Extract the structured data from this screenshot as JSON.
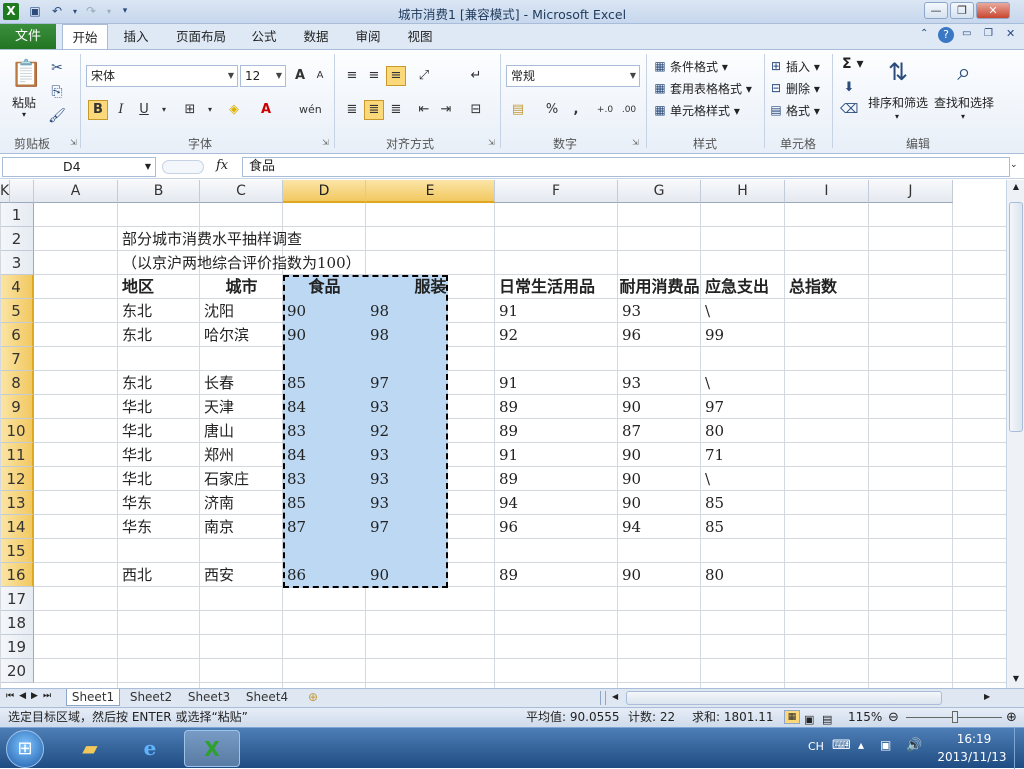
{
  "window": {
    "title": "城市消费1  [兼容模式]  -  Microsoft Excel",
    "app_icon": "X",
    "min": "—",
    "max": "❐",
    "close": "✕"
  },
  "ribbon_tabs": {
    "file": "文件",
    "items": [
      "开始",
      "插入",
      "页面布局",
      "公式",
      "数据",
      "审阅",
      "视图"
    ]
  },
  "ribbon": {
    "clipboard": {
      "paste": "粘贴",
      "label": "剪贴板"
    },
    "font": {
      "name": "宋体",
      "size": "12",
      "grow": "A",
      "shrink": "A",
      "bold": "B",
      "italic": "I",
      "underline": "U",
      "label": "字体"
    },
    "alignment": {
      "label": "对齐方式"
    },
    "number": {
      "format": "常规",
      "percent": "%",
      "comma": ",",
      "inc": "+.0",
      "dec": ".00",
      "label": "数字"
    },
    "styles": {
      "cond": "条件格式",
      "table": "套用表格格式",
      "cell": "单元格样式",
      "label": "样式"
    },
    "cells": {
      "insert": "插入",
      "delete": "删除",
      "format": "格式",
      "label": "单元格"
    },
    "editing": {
      "sigma": "Σ",
      "sort": "排序和筛选",
      "find": "查找和选择",
      "label": "编辑"
    }
  },
  "formula_bar": {
    "name_box": "D4",
    "fx": "fx",
    "value": "食品"
  },
  "columns": [
    "A",
    "B",
    "C",
    "D",
    "E",
    "F",
    "G",
    "H",
    "I",
    "J",
    "K"
  ],
  "rows": [
    "1",
    "2",
    "3",
    "4",
    "5",
    "6",
    "7",
    "8",
    "9",
    "10",
    "11",
    "12",
    "13",
    "14",
    "15",
    "16",
    "17",
    "18",
    "19",
    "20"
  ],
  "sheet": {
    "title": "部分城市消费水平抽样调查",
    "subtitle": "（以京沪两地综合评价指数为100）",
    "headers": [
      "地区",
      "城市",
      "食品",
      "服装",
      "日常生活用品",
      "耐用消费品",
      "应急支出",
      "总指数"
    ],
    "data": [
      {
        "row": 5,
        "cells": [
          "东北",
          "沈阳",
          "90",
          "98",
          "91",
          "93",
          "\\"
        ]
      },
      {
        "row": 6,
        "cells": [
          "东北",
          "哈尔滨",
          "90",
          "98",
          "92",
          "96",
          "99"
        ]
      },
      {
        "row": 8,
        "cells": [
          "东北",
          "长春",
          "85",
          "97",
          "91",
          "93",
          "\\"
        ]
      },
      {
        "row": 9,
        "cells": [
          "华北",
          "天津",
          "84",
          "93",
          "89",
          "90",
          "97"
        ]
      },
      {
        "row": 10,
        "cells": [
          "华北",
          "唐山",
          "83",
          "92",
          "89",
          "87",
          "80"
        ]
      },
      {
        "row": 11,
        "cells": [
          "华北",
          "郑州",
          "84",
          "93",
          "91",
          "90",
          "71"
        ]
      },
      {
        "row": 12,
        "cells": [
          "华北",
          "石家庄",
          "83",
          "93",
          "89",
          "90",
          "\\"
        ]
      },
      {
        "row": 13,
        "cells": [
          "华东",
          "济南",
          "85",
          "93",
          "94",
          "90",
          "85"
        ]
      },
      {
        "row": 14,
        "cells": [
          "华东",
          "南京",
          "87",
          "97",
          "96",
          "94",
          "85"
        ]
      },
      {
        "row": 16,
        "cells": [
          "西北",
          "西安",
          "86",
          "90",
          "89",
          "90",
          "80"
        ]
      }
    ]
  },
  "sheet_tabs": [
    "Sheet1",
    "Sheet2",
    "Sheet3",
    "Sheet4"
  ],
  "status": {
    "message": "选定目标区域，然后按 ENTER 或选择“粘贴”",
    "average": "平均值: 90.0555",
    "count": "计数: 22",
    "sum": "求和: 1801.11",
    "zoom": "115%"
  },
  "taskbar": {
    "lang": "CH",
    "time": "16:19",
    "date": "2013/11/13"
  },
  "colors": {
    "accent_green": "#227622",
    "selection": "#bcd8f3",
    "header_selected": "#f2c861"
  }
}
